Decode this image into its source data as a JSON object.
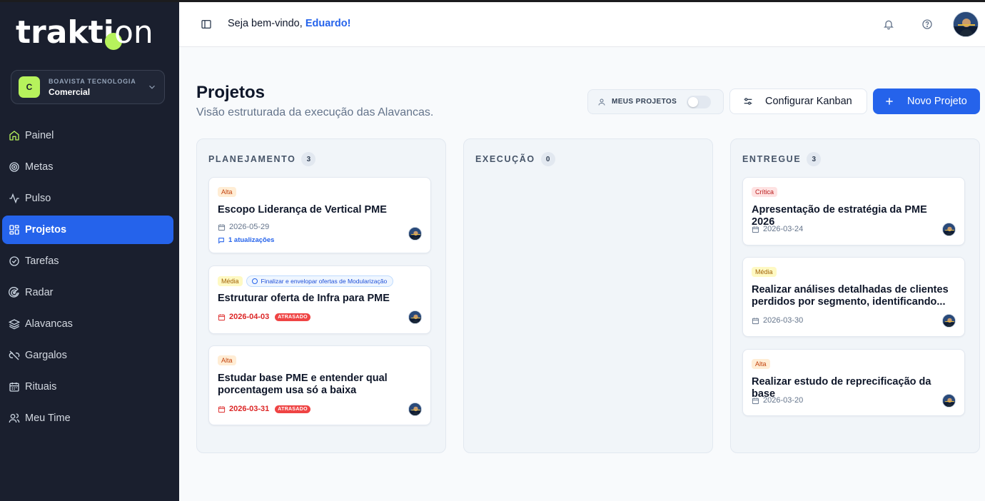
{
  "brand": {
    "logo_text": "traktion"
  },
  "org": {
    "company": "BOAVISTA TECNOLOGIA",
    "team": "Comercial",
    "badge": "C"
  },
  "nav": {
    "items": [
      {
        "label": "Painel",
        "icon": "home-icon"
      },
      {
        "label": "Metas",
        "icon": "target-icon"
      },
      {
        "label": "Pulso",
        "icon": "activity-icon"
      },
      {
        "label": "Projetos",
        "icon": "grid-icon",
        "active": true
      },
      {
        "label": "Tarefas",
        "icon": "check-circle-icon"
      },
      {
        "label": "Radar",
        "icon": "radar-icon"
      },
      {
        "label": "Alavancas",
        "icon": "layers-icon"
      },
      {
        "label": "Gargalos",
        "icon": "unlink-icon"
      },
      {
        "label": "Rituais",
        "icon": "calendar-icon"
      },
      {
        "label": "Meu Time",
        "icon": "users-icon"
      }
    ]
  },
  "header": {
    "welcome": "Seja bem-vindo, ",
    "user_name": "Eduardo!"
  },
  "page": {
    "title": "Projetos",
    "subtitle": "Visão estruturada da execução das Alavancas.",
    "my_projects_label": "MEUS PROJETOS",
    "my_projects_on": false,
    "config_label": "Configurar Kanban",
    "new_label": "Novo Projeto"
  },
  "columns": [
    {
      "title": "PLANEJAMENTO",
      "count": "3",
      "cards": [
        {
          "priority": "Alta",
          "title": "Escopo Liderança de Vertical PME",
          "date": "2026-05-29",
          "updates": "1 atualizações"
        },
        {
          "priority": "Média",
          "lever": "Finalizar e envelopar ofertas de Modularização",
          "title": "Estruturar oferta de Infra para PME",
          "date": "2026-04-03",
          "late": "ATRASADO"
        },
        {
          "priority": "Alta",
          "title": "Estudar base PME e entender qual porcentagem usa só a baixa",
          "date": "2026-03-31",
          "late": "ATRASADO"
        }
      ]
    },
    {
      "title": "EXECUÇÃO",
      "count": "0",
      "cards": []
    },
    {
      "title": "ENTREGUE",
      "count": "3",
      "cards": [
        {
          "priority": "Crítica",
          "title": "Apresentação de estratégia da PME 2026",
          "date": "2026-03-24"
        },
        {
          "priority": "Média",
          "title": "Realizar análises detalhadas de clientes perdidos por segmento, identificando...",
          "date": "2026-03-30"
        },
        {
          "priority": "Alta",
          "title": "Realizar estudo de reprecificação da base",
          "date": "2026-03-20"
        }
      ]
    }
  ],
  "colors": {
    "accent": "#2563eb",
    "brand_green": "#b6f25c",
    "sidebar_bg": "#1a1f2e",
    "late": "#ef4444"
  }
}
